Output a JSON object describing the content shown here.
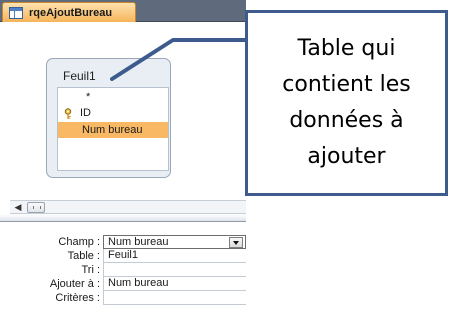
{
  "query_tab": {
    "label": "rqeAjoutBureau",
    "icon": "query-icon"
  },
  "table_box": {
    "title": "Feuil1",
    "fields": [
      {
        "label": "*",
        "icon": ""
      },
      {
        "label": "ID",
        "icon": "key-icon"
      },
      {
        "label": "Num bureau",
        "icon": "",
        "selected": true
      }
    ]
  },
  "design_grid": {
    "rows": [
      {
        "label": "Champ :",
        "value": "Num bureau",
        "dropdown": true
      },
      {
        "label": "Table :",
        "value": "Feuil1"
      },
      {
        "label": "Tri :",
        "value": ""
      },
      {
        "label": "Ajouter à :",
        "value": "Num bureau"
      },
      {
        "label": "Critères :",
        "value": ""
      }
    ]
  },
  "callout": {
    "text": "Table qui contient les données à ajouter"
  },
  "colors": {
    "tab_accent": "#f6b45a",
    "selection": "#f8b864",
    "callout_border": "#3d5b8d"
  }
}
